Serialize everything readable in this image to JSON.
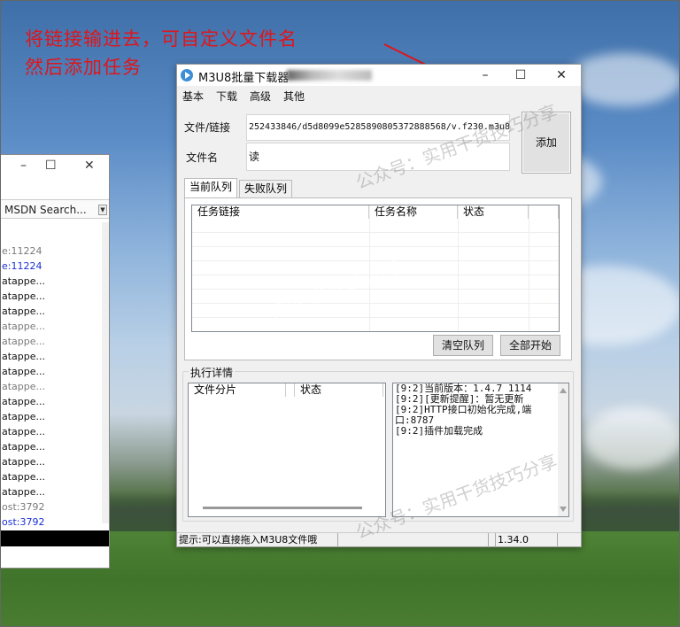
{
  "annotation": {
    "line1": "将链接输进去，可自定义文件名",
    "line2": "然后添加任务"
  },
  "left_window": {
    "controls": {
      "minimize": "–",
      "maximize": "☐",
      "close": "✕"
    },
    "search_placeholder": "MSDN Search...",
    "items": [
      {
        "text": "e:11224",
        "color": "#7a7a7a"
      },
      {
        "text": "e:11224",
        "color": "#1a2fd6"
      },
      {
        "text": "atappe...",
        "color": "#111111"
      },
      {
        "text": "atappe...",
        "color": "#111111"
      },
      {
        "text": "atappe...",
        "color": "#111111"
      },
      {
        "text": "atappe...",
        "color": "#7a7a7a"
      },
      {
        "text": "atappe...",
        "color": "#7a7a7a"
      },
      {
        "text": "atappe...",
        "color": "#111111"
      },
      {
        "text": "atappe...",
        "color": "#111111"
      },
      {
        "text": "atappe...",
        "color": "#7a7a7a"
      },
      {
        "text": "atappe...",
        "color": "#111111"
      },
      {
        "text": "atappe...",
        "color": "#111111"
      },
      {
        "text": "atappe...",
        "color": "#111111"
      },
      {
        "text": "atappe...",
        "color": "#111111"
      },
      {
        "text": "atappe...",
        "color": "#111111"
      },
      {
        "text": "atappe...",
        "color": "#111111"
      },
      {
        "text": "atappe...",
        "color": "#111111"
      },
      {
        "text": "ost:3792",
        "color": "#7a7a7a"
      },
      {
        "text": "ost:3792",
        "color": "#1a2fd6"
      }
    ]
  },
  "main_window": {
    "title": "M3U8批量下载器",
    "controls": {
      "minimize": "–",
      "maximize": "☐",
      "close": "✕"
    },
    "menu": [
      "基本",
      "下载",
      "高级",
      "其他"
    ],
    "url_label": "文件/链接",
    "url_value": "252433846/d5d8099e528589080537288856​8/v.f230.m3u8",
    "filename_label": "文件名",
    "filename_value": "读",
    "add_button": "添加",
    "tabs": [
      "当前队列",
      "失败队列"
    ],
    "queue_columns": [
      "任务链接",
      "任务名称",
      "状态"
    ],
    "clear_button": "清空队列",
    "start_all_button": "全部开始",
    "exec_group_title": "执行详情",
    "segment_columns": [
      "文件分片",
      "",
      "状态"
    ],
    "log": [
      "[9:2]当前版本：1.4.7 1114",
      "[9:2][更新提醒]：暂无更新",
      "[9:2]HTTP接口初始化完成,端口:8787",
      "[9:2]插件加载完成"
    ],
    "status_hint": "提示:可以直接拖入M3U8文件哦",
    "status_version": "1.34.0"
  },
  "watermark": {
    "text1": "公众号：实用干货技巧分享",
    "text2": "实用干货技巧分享",
    "text3": "公众号：实用干货技巧分享"
  }
}
